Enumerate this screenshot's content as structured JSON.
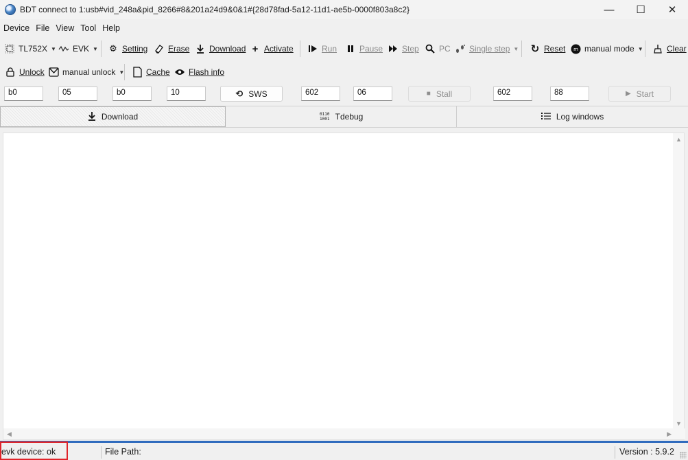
{
  "window": {
    "title": "BDT connect to 1:usb#vid_248a&pid_8266#8&201a24d9&0&1#{28d78fad-5a12-11d1-ae5b-0000f803a8c2}",
    "controls": [
      "—",
      "☐",
      "✕"
    ]
  },
  "menu": [
    "Device",
    "File",
    "View",
    "Tool",
    "Help"
  ],
  "toolbar1": {
    "chip": "TL752X",
    "evk": "EVK",
    "setting": "Setting",
    "erase": "Erase",
    "download": "Download",
    "activate": "Activate",
    "run": "Run",
    "pause": "Pause",
    "step": "Step",
    "pc": "PC",
    "single_step": "Single step",
    "reset": "Reset",
    "mode": "manual mode",
    "clear": "Clear"
  },
  "toolbar2": {
    "unlock": "Unlock",
    "manual_unlock": "manual unlock",
    "cache": "Cache",
    "flash_info": "Flash info"
  },
  "registers": {
    "r1": "b0",
    "r2": "05",
    "r3": "b0",
    "r4": "10",
    "sws": "SWS",
    "r5": "602",
    "r6": "06",
    "stall": "Stall",
    "r7": "602",
    "r8": "88",
    "start": "Start"
  },
  "tabs": [
    {
      "label": "Download",
      "active": true
    },
    {
      "label": "Tdebug",
      "active": false
    },
    {
      "label": "Log windows",
      "active": false
    }
  ],
  "status": {
    "device": "evk device: ok",
    "file_path": "File Path:",
    "version": "Version : 5.9.2"
  },
  "colors": {
    "accent": "#2f6bbd",
    "highlight": "#e0242a"
  }
}
